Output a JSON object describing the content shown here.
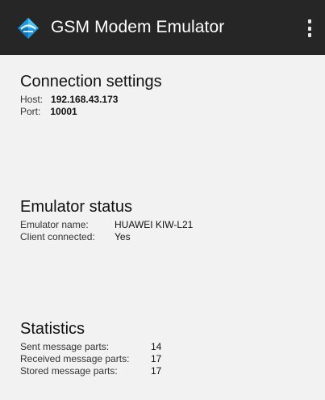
{
  "app": {
    "title": "GSM Modem Emulator",
    "icon": "diamond-logo-icon",
    "menu_icon": "overflow-menu-icon",
    "colors": {
      "appbar": "#262626",
      "background": "#f2f2f2",
      "icon_blue": "#1e9be0"
    }
  },
  "connection": {
    "title": "Connection settings",
    "host_label": "Host:",
    "host_value": "192.168.43.173",
    "port_label": "Port:",
    "port_value": "10001"
  },
  "emulator": {
    "title": "Emulator status",
    "name_label": "Emulator name:",
    "name_value": "HUAWEI KIW-L21",
    "client_label": "Client connected:",
    "client_value": "Yes"
  },
  "statistics": {
    "title": "Statistics",
    "sent_label": "Sent message parts:",
    "sent_value": "14",
    "received_label": "Received message parts:",
    "received_value": "17",
    "stored_label": "Stored message parts:",
    "stored_value": "17"
  }
}
